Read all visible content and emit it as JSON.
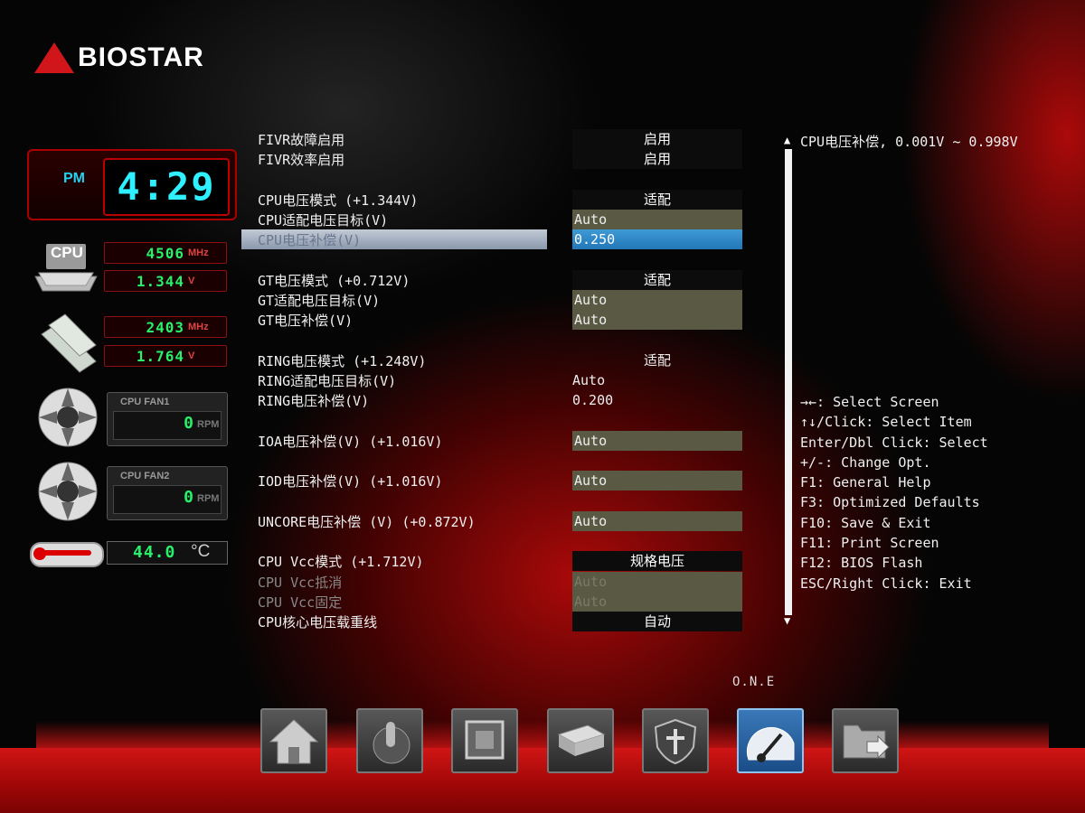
{
  "brand": {
    "name": "BIOSTAR"
  },
  "clock": {
    "ampm": "PM",
    "time": "4:29"
  },
  "cpu": {
    "label": "CPU",
    "freq": "4506",
    "freq_unit": "MHz",
    "volt": "1.344",
    "volt_unit": "V"
  },
  "memory": {
    "freq": "2403",
    "freq_unit": "MHz",
    "volt": "1.764",
    "volt_unit": "V"
  },
  "fans": [
    {
      "title": "CPU FAN1",
      "value": "0",
      "unit": "RPM"
    },
    {
      "title": "CPU FAN2",
      "value": "0",
      "unit": "RPM"
    }
  ],
  "temperature": {
    "value": "44.0",
    "unit": "°C"
  },
  "settings": [
    {
      "label": "FIVR故障启用",
      "value": "启用"
    },
    {
      "label": "FIVR效率启用",
      "value": "启用"
    },
    {
      "label": "CPU电压模式 (+1.344V)",
      "value": "适配"
    },
    {
      "label": "CPU适配电压目标(V)",
      "value": "Auto"
    },
    {
      "label": "CPU电压补偿(V)",
      "value": "0.250"
    },
    {
      "label": "GT电压模式 (+0.712V)",
      "value": "适配"
    },
    {
      "label": "GT适配电压目标(V)",
      "value": "Auto"
    },
    {
      "label": "GT电压补偿(V)",
      "value": "Auto"
    },
    {
      "label": "RING电压模式 (+1.248V)",
      "value": "适配"
    },
    {
      "label": "RING适配电压目标(V)",
      "value": "Auto"
    },
    {
      "label": "RING电压补偿(V)",
      "value": "0.200"
    },
    {
      "label": "IOA电压补偿(V) (+1.016V)",
      "value": "Auto"
    },
    {
      "label": "IOD电压补偿(V) (+1.016V)",
      "value": "Auto"
    },
    {
      "label": "UNCORE电压补偿 (V) (+0.872V)",
      "value": "Auto"
    },
    {
      "label": "CPU Vcc模式 (+1.712V)",
      "value": "规格电压"
    },
    {
      "label": "CPU Vcc抵消",
      "value": "Auto"
    },
    {
      "label": "CPU Vcc固定",
      "value": "Auto"
    },
    {
      "label": "CPU核心电压载重线",
      "value": "自动"
    }
  ],
  "help": {
    "description": "CPU电压补偿, 0.001V ~ 0.998V",
    "keys": [
      "→←: Select Screen",
      "↑↓/Click: Select Item",
      "Enter/Dbl Click: Select",
      "+/-: Change Opt.",
      "F1: General Help",
      "F3: Optimized Defaults",
      "F10: Save & Exit",
      "F11: Print Screen",
      "F12: BIOS Flash",
      "ESC/Right Click: Exit"
    ]
  },
  "nav": {
    "active_label": "O.N.E",
    "items": [
      "home-icon",
      "joystick-icon",
      "chip-icon",
      "drives-icon",
      "shield-icon",
      "speedometer-icon",
      "folder-exit-icon"
    ],
    "active_index": 5
  },
  "colors": {
    "accent_red": "#d0161a",
    "lcd_green": "#27f06a",
    "lcd_cyan": "#2ff0ff",
    "selected_blue": "#2d88c8"
  }
}
